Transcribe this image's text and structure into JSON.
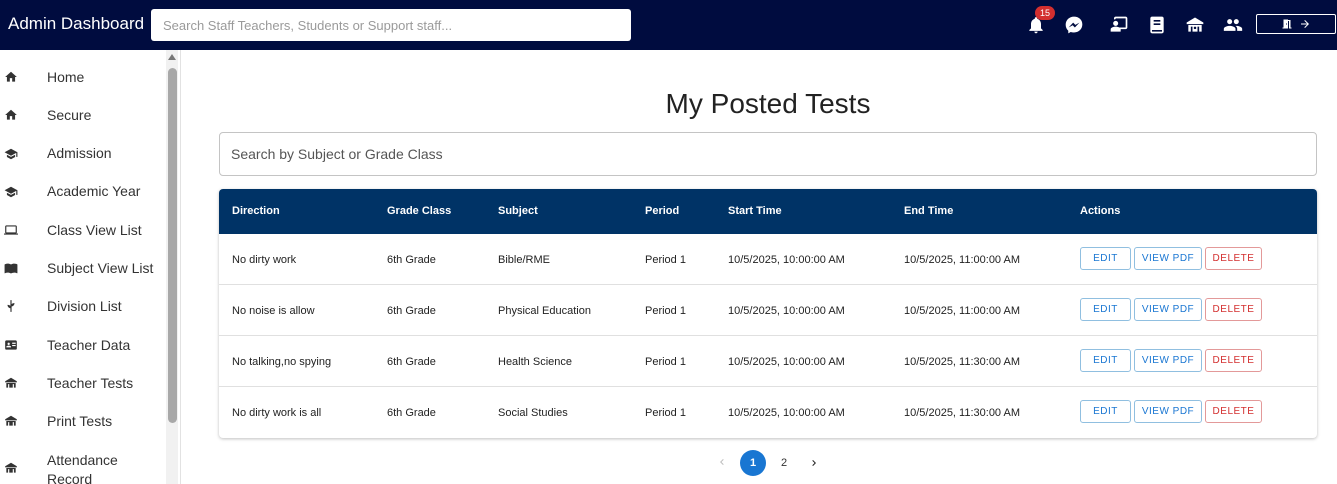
{
  "header": {
    "title": "Admin Dashboard",
    "search_placeholder": "Search Staff Teachers, Students or Support staff...",
    "notification_count": "15",
    "icons": [
      "bell-icon",
      "messenger-icon",
      "teacher-board-icon",
      "book-icon",
      "school-icon",
      "people-icon",
      "logout-icon"
    ]
  },
  "sidebar": {
    "items": [
      {
        "label": "Home",
        "icon": "home-icon"
      },
      {
        "label": "Secure",
        "icon": "home-icon"
      },
      {
        "label": "Admission",
        "icon": "graduation-cap-icon"
      },
      {
        "label": "Academic Year",
        "icon": "graduation-cap-icon"
      },
      {
        "label": "Class View List",
        "icon": "laptop-icon"
      },
      {
        "label": "Subject View List",
        "icon": "open-book-icon"
      },
      {
        "label": "Division List",
        "icon": "plant-icon"
      },
      {
        "label": "Teacher Data",
        "icon": "id-card-icon"
      },
      {
        "label": "Teacher Tests",
        "icon": "school-icon"
      },
      {
        "label": "Print Tests",
        "icon": "school-icon"
      },
      {
        "label": "Attendance Record",
        "icon": "school-icon"
      }
    ]
  },
  "main": {
    "title": "My Posted Tests",
    "filter_placeholder": "Search by Subject or Grade Class",
    "table": {
      "headers": [
        "Direction",
        "Grade Class",
        "Subject",
        "Period",
        "Start Time",
        "End Time",
        "Actions"
      ],
      "rows": [
        [
          "No dirty work",
          "6th Grade",
          "Bible/RME",
          "Period 1",
          "10/5/2025, 10:00:00 AM",
          "10/5/2025, 11:00:00 AM"
        ],
        [
          "No noise is allow",
          "6th Grade",
          "Physical Education",
          "Period 1",
          "10/5/2025, 10:00:00 AM",
          "10/5/2025, 11:00:00 AM"
        ],
        [
          "No talking,no spying",
          "6th Grade",
          "Health Science",
          "Period 1",
          "10/5/2025, 10:00:00 AM",
          "10/5/2025, 11:30:00 AM"
        ],
        [
          "No dirty work is all",
          "6th Grade",
          "Social Studies",
          "Period 1",
          "10/5/2025, 10:00:00 AM",
          "10/5/2025, 11:30:00 AM"
        ]
      ],
      "actions": {
        "edit": "EDIT",
        "view_pdf": "VIEW PDF",
        "delete": "DELETE"
      }
    },
    "pagination": {
      "pages": [
        "1",
        "2"
      ],
      "current": "1"
    }
  },
  "colors": {
    "header_bg": "#000c3f",
    "table_header_bg": "#003366",
    "primary": "#1976d2",
    "danger": "#d32f2f"
  }
}
